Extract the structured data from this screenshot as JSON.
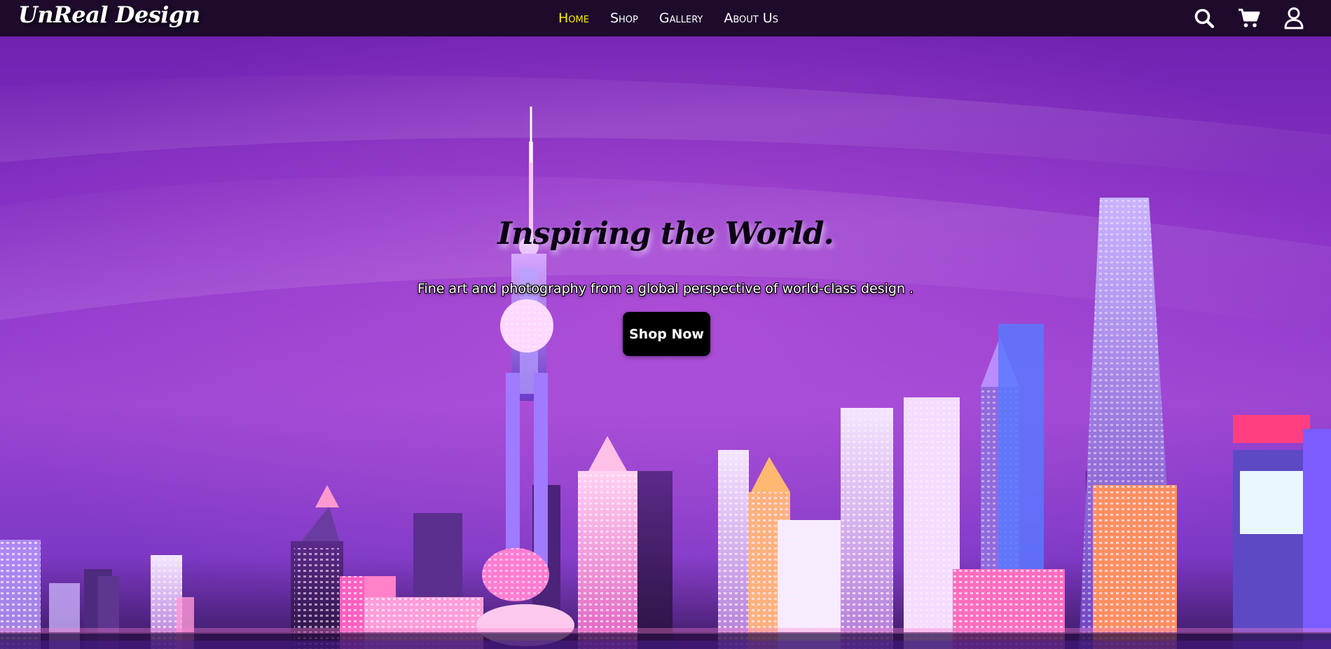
{
  "brand": {
    "name": "UnReal Design"
  },
  "nav": {
    "links": [
      {
        "label": "Home",
        "active": true
      },
      {
        "label": "Shop",
        "active": false
      },
      {
        "label": "Gallery",
        "active": false
      },
      {
        "label": "About Us",
        "active": false
      }
    ],
    "icons": [
      "search-icon",
      "cart-icon",
      "user-icon"
    ]
  },
  "hero": {
    "title": "Inspiring the World.",
    "subtitle": "Fine art and photography from a global perspective of world-class design .",
    "cta_label": "Shop Now",
    "background": "Night city skyline with purple sky"
  },
  "colors": {
    "navbar": "#1e0b2c",
    "active_link": "#ffea00",
    "sky": "#8a2bc8",
    "button": "#000000"
  }
}
